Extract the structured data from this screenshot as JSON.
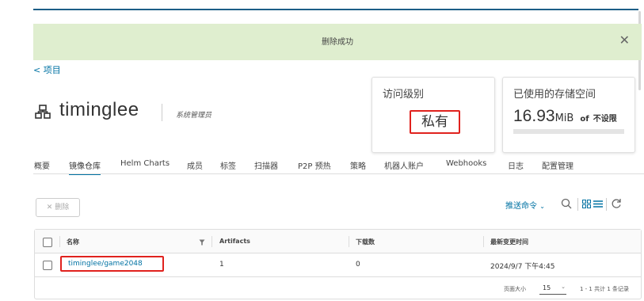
{
  "alert": {
    "message": "删除成功",
    "close_icon": "close-icon"
  },
  "breadcrumb": {
    "back_label": "< 项目"
  },
  "project": {
    "name": "timinglee",
    "role": "系统管理员",
    "icon": "project-icon"
  },
  "access_card": {
    "title": "访问级别",
    "value": "私有"
  },
  "storage_card": {
    "title": "已使用的存储空间",
    "used": "16.93",
    "unit": "MiB",
    "of_text": "of",
    "quota": "不设限",
    "usage_fraction": 0.0,
    "bar_color": "#3a9c3a"
  },
  "tabs": [
    {
      "label": "概要",
      "active": false
    },
    {
      "label": "镜像仓库",
      "active": true
    },
    {
      "label": "Helm Charts",
      "active": false
    },
    {
      "label": "成员",
      "active": false
    },
    {
      "label": "标签",
      "active": false
    },
    {
      "label": "扫描器",
      "active": false
    },
    {
      "label": "P2P 预热",
      "active": false
    },
    {
      "label": "策略",
      "active": false
    },
    {
      "label": "机器人账户",
      "active": false
    },
    {
      "label": "Webhooks",
      "active": false
    },
    {
      "label": "日志",
      "active": false
    },
    {
      "label": "配置管理",
      "active": false
    }
  ],
  "toolbar": {
    "delete_label": "✕ 删除",
    "push_command_label": "推送命令",
    "push_chevron": "⌄"
  },
  "table": {
    "columns": [
      "名称",
      "Artifacts",
      "下载数",
      "最新变更时间"
    ],
    "rows": [
      {
        "name": "timinglee/game2048",
        "artifacts": "1",
        "pulls": "0",
        "updated": "2024/9/7 下午4:45"
      }
    ]
  },
  "pagination": {
    "page_size_label": "页面大小",
    "page_size": "15",
    "summary": "1 - 1 共计 1 条记录"
  },
  "colors": {
    "accent": "#0072a3",
    "alert_bg": "#dfeecf",
    "highlight": "#e0221e"
  }
}
